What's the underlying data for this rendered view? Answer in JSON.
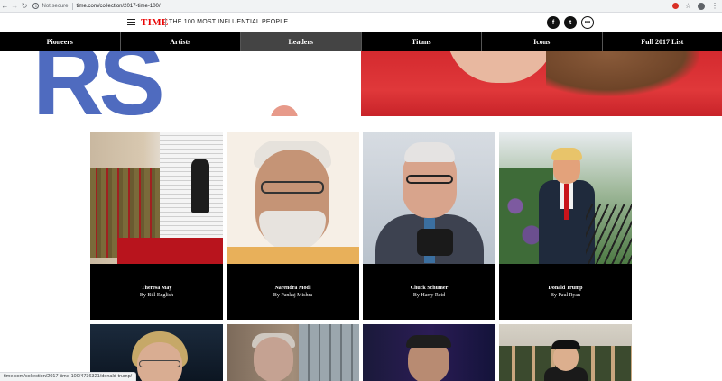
{
  "browser": {
    "security_label": "Not secure",
    "url": "time.com/collection/2017-time-100/"
  },
  "site": {
    "logo": "TIME",
    "tagline": "THE 100 MOST INFLUENTIAL PEOPLE",
    "social": {
      "facebook": "f",
      "twitter": "t",
      "more": "•••"
    }
  },
  "tabs": [
    {
      "label": "Pioneers",
      "active": false
    },
    {
      "label": "Artists",
      "active": false
    },
    {
      "label": "Leaders",
      "active": true
    },
    {
      "label": "Titans",
      "active": false
    },
    {
      "label": "Icons",
      "active": false
    },
    {
      "label": "Full 2017 List",
      "active": false
    }
  ],
  "hero": {
    "letters": "RS"
  },
  "cards": [
    {
      "name": "Theresa May",
      "byline": "By Bill English"
    },
    {
      "name": "Narendra Modi",
      "byline": "By Pankaj Mishra"
    },
    {
      "name": "Chuck Schumer",
      "byline": "By Harry Reid"
    },
    {
      "name": "Donald Trump",
      "byline": "By Paul Ryan"
    }
  ],
  "status_bar": {
    "link": "time.com/collection/2017-time-100/4736321/donald-trump/"
  }
}
